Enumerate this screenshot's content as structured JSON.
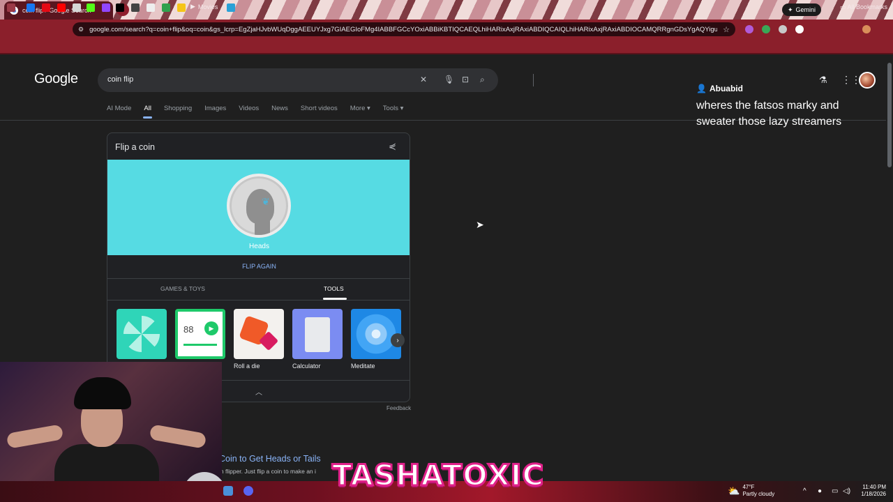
{
  "browser": {
    "tab_title": "coin flip - Google Search",
    "tab_close": "✕",
    "gemini_label": "Gemini",
    "url": "google.com/search?q=coin+flip&oq=coin&gs_lcrp=EgZjaHJvbWUqDggAEEUYJxg7GIAEGIoFMg4IABBFGCcYOxiABBiKBTIQCAEQLhiHARixAxjRAxiABDIQCAIQLhiHARixAxjRAxiABDIOCAMQRRgnGDsYgAQYiguYCggGEEAA...",
    "bookmark_movies": "Movies",
    "all_bookmarks": "All Bookmarks"
  },
  "google": {
    "logo": "Google",
    "query": "coin flip",
    "tabs": [
      "AI Mode",
      "All",
      "Shopping",
      "Images",
      "Videos",
      "News",
      "Short videos",
      "More ▾",
      "Tools ▾"
    ]
  },
  "userpanel": {
    "username": "Abuabid",
    "message": "wheres the fatsos marky and sweater those lazy streamers"
  },
  "card": {
    "title": "Flip a coin",
    "result": "Heads",
    "flip_again": "FLIP AGAIN",
    "tab_games": "GAMES & TOYS",
    "tab_tools": "TOOLS",
    "tools": [
      {
        "label": "",
        "color": "#2fd5b8"
      },
      {
        "label": "",
        "color": "#1ec96a"
      },
      {
        "label": "Roll a die",
        "color": "#f3f1ee"
      },
      {
        "label": "Calculator",
        "color": "#7b8cf2"
      },
      {
        "label": "Meditate",
        "color": "#1e88e5"
      }
    ],
    "metronome_value": "88",
    "feedback": "Feedback"
  },
  "result": {
    "title": "Coin to Get Heads or Tails",
    "snippet": "in flipper. Just flip a coin to make an i"
  },
  "overlay": {
    "brand": "TASHATOXIC"
  },
  "taskbar": {
    "temp": "47°F",
    "condition": "Partly cloudy",
    "time": "11:40 PM",
    "date": "1/18/2026"
  }
}
